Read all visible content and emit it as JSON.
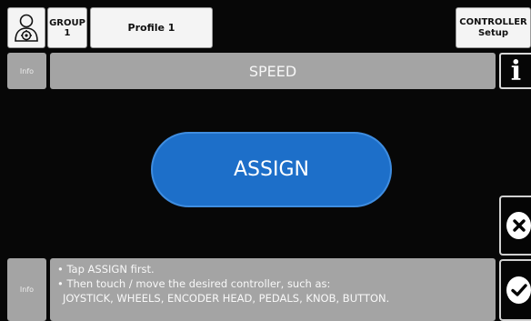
{
  "header": {
    "group_label": "GROUP",
    "group_number": "1",
    "profile_label": "Profile 1",
    "controller_label": "CONTROLLER",
    "controller_sub": "Setup"
  },
  "info_top_label": "Info",
  "title": "SPEED",
  "info_button_glyph": "i",
  "assign_label": "ASSIGN",
  "info_bottom_label": "Info",
  "help": {
    "line1": "• Tap ASSIGN first.",
    "line2": "• Then touch / move the desired controller, such as:",
    "line3": "JOYSTICK, WHEELS, ENCODER HEAD, PEDALS, KNOB, BUTTON."
  },
  "icons": {
    "user": "user-settings-icon",
    "cancel": "close-icon",
    "confirm": "check-icon"
  },
  "colors": {
    "assign_fill": "#1d6fc9",
    "panel_gray": "#a4a4a4",
    "background": "#070707"
  }
}
